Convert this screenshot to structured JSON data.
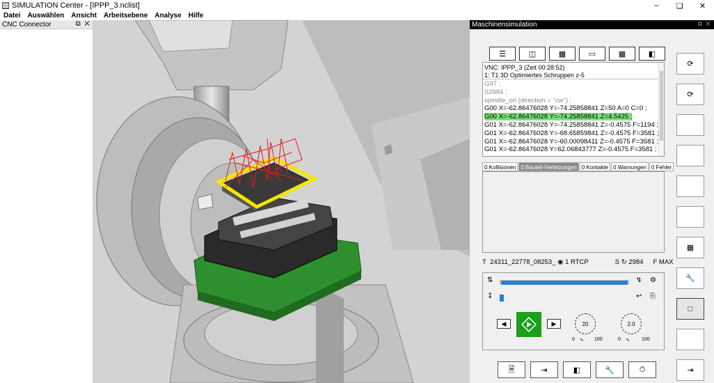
{
  "window": {
    "title": "SIMULATION Center - [IPPP_3.nclist]"
  },
  "menu": [
    "Datei",
    "Auswählen",
    "Ansicht",
    "Arbeitsebene",
    "Analyse",
    "Hilfe"
  ],
  "left_panel": {
    "title": "CNC Connector"
  },
  "right_panel": {
    "title": "Maschinensimulation",
    "code_header": [
      "VNC: IPPP_3 (Zeit 00:28:52)",
      "1: T1 3D Optimiertes Schruppen z-5"
    ],
    "code_lines": [
      "G97 ;",
      "S2984 ;",
      "spindle_on (direction = \"cw\") ;",
      "G00 X=-62.86476028 Y=-74.25858841 Z=50 A=0 C=0 ;",
      "G00 X=-62.86476028 Y=-74.25858841 Z=4.5425 ;",
      "G01 X=-62.86476028 Y=-74.25858841 Z=-0.4575 F=1194 ;",
      "G01 X=-62.86476028 Y=-68.65859841 Z=-0.4575 F=3581 ;",
      "G01 X=-62.86476028 Y=-60.00098411 Z=-0.4575 F=3581 ;",
      "G01 X=-62.86476028 Y=62.06843777 Z=-0.4575 F=3581 ;"
    ],
    "tabs": [
      "0 Kollisionen",
      "0 Bauteil-Verletzungen",
      "0 Kontakte",
      "0 Warnungen",
      "0 Fehler"
    ],
    "status": {
      "tool_label": "T",
      "tool": "24311_22778_08253_",
      "rtcp_num": "1",
      "rtcp": "RTCP",
      "s_label": "S",
      "speed": "2984",
      "f_label": "F",
      "feed": "MAX"
    },
    "dials": [
      {
        "value": "20",
        "min": "0",
        "max": "100"
      },
      {
        "value": "2.0",
        "min": "0",
        "max": "100"
      }
    ]
  },
  "colors": {
    "accent": "#2a7fd0",
    "play": "#1aa01a",
    "highlight": "#7de07d",
    "fixture": "#2d8f2d",
    "toolpath": "#e51b1b",
    "stock_outline": "#f4e600"
  }
}
